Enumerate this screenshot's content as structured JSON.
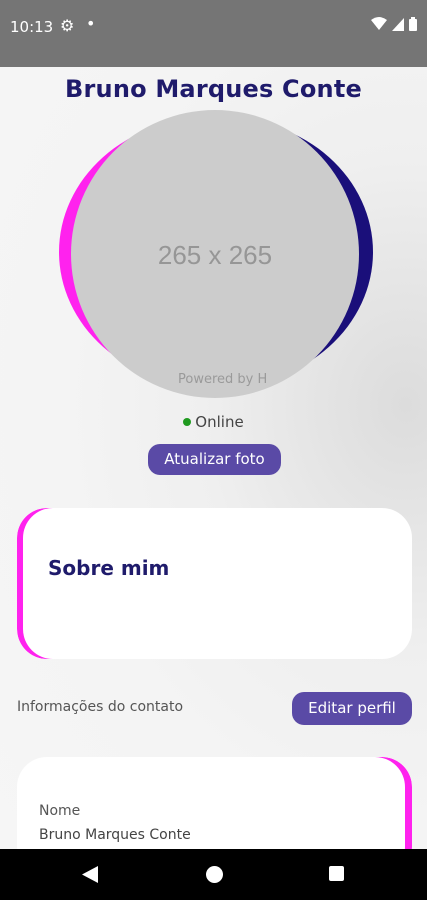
{
  "status_bar": {
    "time": "10:13"
  },
  "profile": {
    "name": "Bruno Marques Conte",
    "avatar_placeholder": "265 x 265",
    "avatar_watermark": "Powered by H",
    "status": "Online",
    "update_photo_label": "Atualizar foto"
  },
  "about": {
    "title": "Sobre mim"
  },
  "contact": {
    "section_label": "Informações do contato",
    "edit_label": "Editar perfil",
    "fields": [
      {
        "label": "Nome",
        "value": "Bruno Marques Conte"
      }
    ]
  },
  "colors": {
    "accent_magenta": "#ff22ee",
    "accent_navy": "#1a0f7a",
    "button": "#5a4aa6",
    "title": "#1f1b6b",
    "online": "#1f9a1f"
  }
}
